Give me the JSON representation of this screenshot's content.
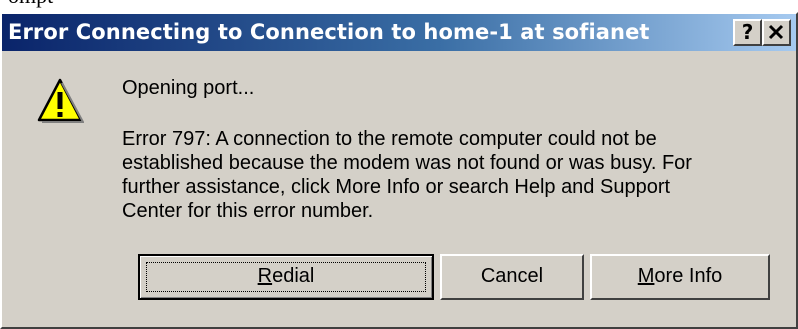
{
  "caption": "ompt",
  "window": {
    "title": "Error Connecting to Connection to home-1 at sofianet",
    "help_button": "?",
    "close_button": "×"
  },
  "message": {
    "status": "Opening port...",
    "error_lines": [
      "Error 797: A connection to the remote computer could not be",
      "established because the modem was not found or was busy. For",
      "further assistance, click More Info or search Help and Support",
      "Center for this error number."
    ]
  },
  "buttons": {
    "redial": {
      "mnemonic": "R",
      "rest": "edial"
    },
    "cancel": "Cancel",
    "more_info": {
      "mnemonic": "M",
      "rest": "ore Info"
    }
  },
  "icons": {
    "warning": "warning-icon"
  },
  "colors": {
    "title_start": "#0a246a",
    "title_end": "#a6caf0",
    "dialog_bg": "#d4d0c8",
    "warning_fill": "#ffff00"
  }
}
